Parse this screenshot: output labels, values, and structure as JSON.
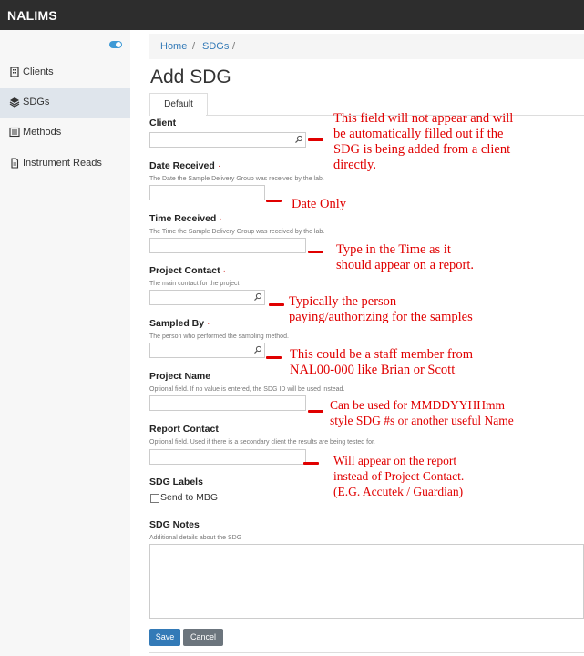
{
  "app": {
    "title": "NALIMS"
  },
  "sidebar": {
    "items": [
      {
        "label": "Clients",
        "icon": "building-icon"
      },
      {
        "label": "SDGs",
        "icon": "layers-icon"
      },
      {
        "label": "Methods",
        "icon": "list-icon"
      },
      {
        "label": "Instrument Reads",
        "icon": "document-icon"
      }
    ],
    "active_index": 1
  },
  "breadcrumb": {
    "home": "Home",
    "sep1": "/",
    "sdgs": "SDGs",
    "sep2": "/"
  },
  "page": {
    "title": "Add SDG",
    "tab": "Default"
  },
  "form": {
    "client": {
      "label": "Client",
      "value": ""
    },
    "date_received": {
      "label": "Date Received",
      "required": "·",
      "help": "The Date the Sample Delivery Group was received by the lab.",
      "value": ""
    },
    "time_received": {
      "label": "Time Received",
      "required": "·",
      "help": "The Time the Sample Delivery Group was received by the lab.",
      "value": ""
    },
    "project_contact": {
      "label": "Project Contact",
      "required": "·",
      "help": "The main contact for the project",
      "value": ""
    },
    "sampled_by": {
      "label": "Sampled By",
      "required": "·",
      "help": "The person who performed the sampling method.",
      "value": ""
    },
    "project_name": {
      "label": "Project Name",
      "help": "Optional field. If no value is entered, the SDG ID will be used instead.",
      "value": ""
    },
    "report_contact": {
      "label": "Report Contact",
      "help": "Optional field. Used if there is a secondary client the results are being tested for.",
      "value": ""
    },
    "sdg_labels": {
      "label": "SDG Labels",
      "option": "Send to MBG",
      "checked": false
    },
    "sdg_notes": {
      "label": "SDG Notes",
      "help": "Additional details about the SDG",
      "value": ""
    },
    "save_label": "Save",
    "cancel_label": "Cancel"
  },
  "annotations": {
    "client": [
      "This field will not appear and will",
      "be automatically filled out if the",
      "SDG is being added from a client",
      "directly."
    ],
    "date": [
      "Date Only"
    ],
    "time": [
      "Type in the Time as it",
      "should appear on a report."
    ],
    "project_contact": [
      "Typically the person",
      "paying/authorizing for the samples"
    ],
    "sampled_by": [
      "This could be a staff member from",
      "NAL00-000 like Brian or Scott"
    ],
    "project_name": [
      "Can be used for MMDDYYHHmm",
      "style SDG #s or another useful Name"
    ],
    "report_contact": [
      "Will appear on the report",
      "instead of Project Contact.",
      "(E.G. Accutek / Guardian)"
    ]
  },
  "colors": {
    "topbar": "#2d2d2d",
    "accent": "#337ab7",
    "annotation": "#e00000",
    "sidebar_active": "#dfe5ec"
  }
}
